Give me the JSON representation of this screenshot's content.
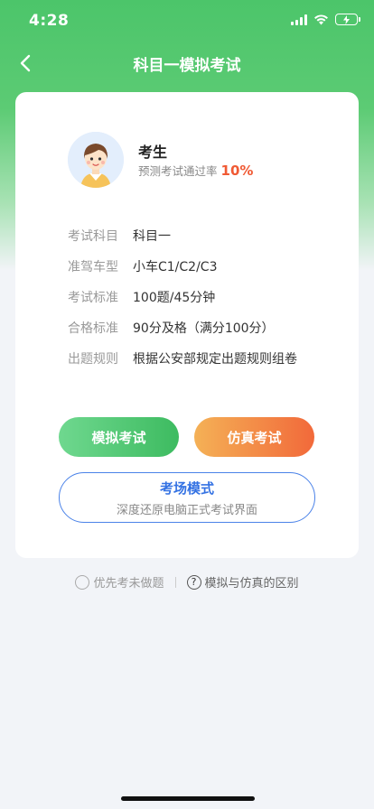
{
  "status_bar": {
    "time": "4:28"
  },
  "nav": {
    "title": "科目一模拟考试",
    "back_icon": "chevron-left"
  },
  "profile": {
    "name": "考生",
    "pass_rate_label": "预测考试通过率",
    "pass_rate_value": "10%"
  },
  "info": [
    {
      "label": "考试科目",
      "value": "科目一"
    },
    {
      "label": "准驾车型",
      "value": "小车C1/C2/C3"
    },
    {
      "label": "考试标准",
      "value": "100题/45分钟"
    },
    {
      "label": "合格标准",
      "value": "90分及格（满分100分）"
    },
    {
      "label": "出题规则",
      "value": "根据公安部规定出题规则组卷"
    }
  ],
  "buttons": {
    "mock": "模拟考试",
    "real": "仿真考试",
    "exam_mode_title": "考场模式",
    "exam_mode_subtitle": "深度还原电脑正式考试界面"
  },
  "options": {
    "unseen_first": "优先考未做题",
    "difference": "模拟与仿真的区别",
    "help_glyph": "?"
  },
  "colors": {
    "brand_green": "#4cc56a",
    "rate_red": "#f05a34",
    "exam_blue": "#3472e3",
    "real_orange": "#f2693a"
  }
}
